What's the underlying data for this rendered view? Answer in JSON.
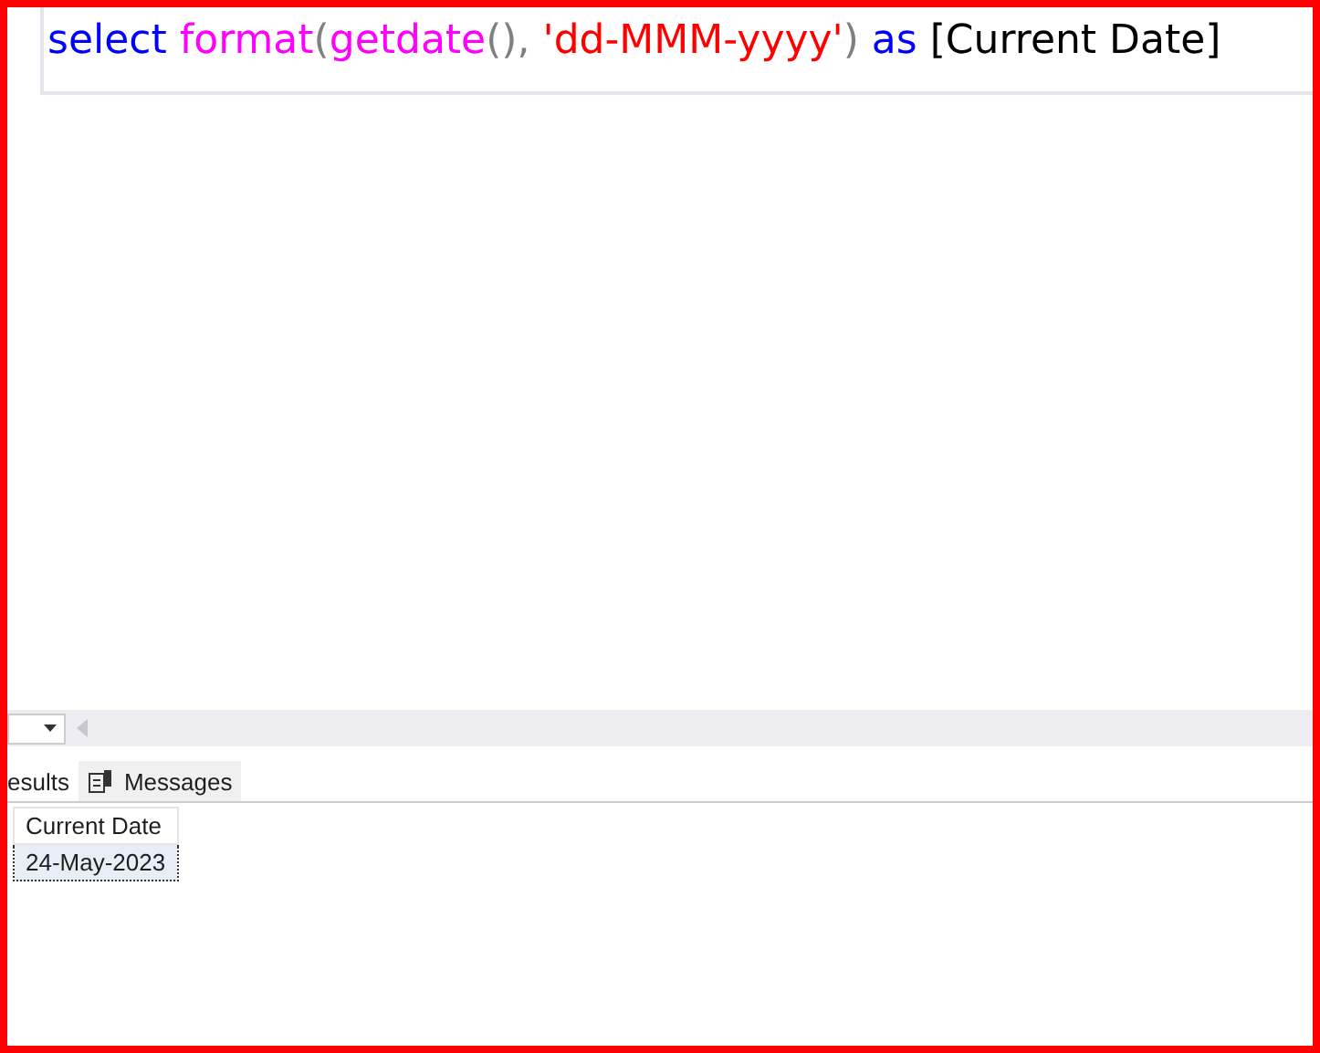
{
  "editor": {
    "code": [
      {
        "text": "select ",
        "kind": "keyword"
      },
      {
        "text": "format",
        "kind": "function"
      },
      {
        "text": "(",
        "kind": "operator"
      },
      {
        "text": "getdate",
        "kind": "function"
      },
      {
        "text": "()",
        "kind": "operator"
      },
      {
        "text": ", ",
        "kind": "operator"
      },
      {
        "text": "'dd-MMM-yyyy'",
        "kind": "string"
      },
      {
        "text": ") ",
        "kind": "operator"
      },
      {
        "text": "as",
        "kind": "keyword"
      },
      {
        "text": " [Current Date]",
        "kind": "plain"
      }
    ]
  },
  "tabs": [
    {
      "label": "esults",
      "selected": true,
      "icon": false
    },
    {
      "label": "Messages",
      "selected": false,
      "icon": true
    }
  ],
  "grid": {
    "columns": [
      "Current Date"
    ],
    "rows": [
      [
        "24-May-2023"
      ]
    ]
  }
}
